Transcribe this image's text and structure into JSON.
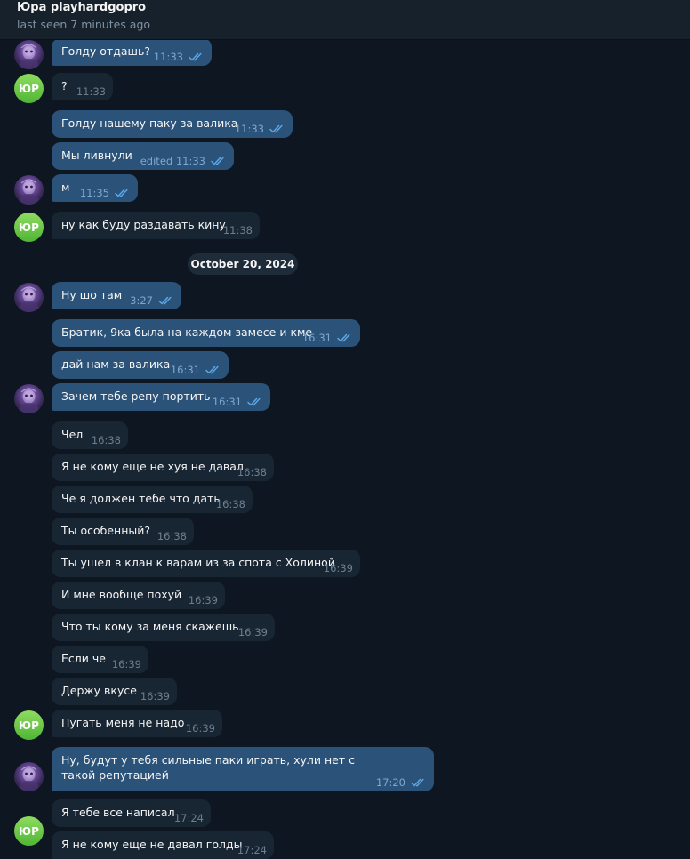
{
  "header": {
    "title": "Юра playhardgopro",
    "status": "last seen 7 minutes ago"
  },
  "colors": {
    "background": "#0e1621",
    "outgoing_bubble": "#2b5278",
    "incoming_bubble": "#182533",
    "read_ticks": "#5aa7e8"
  },
  "avatar_initials": "ЮР",
  "date_separator": "October 20, 2024",
  "messages": [
    {
      "dir": "out",
      "text": "Голду отдашь?",
      "time": "11:33"
    },
    {
      "dir": "in",
      "text": "?",
      "time": "11:33"
    },
    {
      "dir": "out",
      "text": "Голду нашему паку за валика",
      "time": "11:33"
    },
    {
      "dir": "out",
      "text": "Мы ливнули",
      "time": "edited 11:33"
    },
    {
      "dir": "out",
      "text": "м",
      "time": "11:35"
    },
    {
      "dir": "in",
      "text": "ну как буду раздавать кину",
      "time": "11:38"
    },
    {
      "dir": "out",
      "text": "Ну шо там",
      "time": "3:27"
    },
    {
      "dir": "out",
      "text": "Братик, 9ка была на каждом замесе и кме",
      "time": "16:31"
    },
    {
      "dir": "out",
      "text": "дай нам за валика",
      "time": "16:31"
    },
    {
      "dir": "out",
      "text": "Зачем тебе репу портить",
      "time": "16:31"
    },
    {
      "dir": "in",
      "text": "Чел",
      "time": "16:38"
    },
    {
      "dir": "in",
      "text": "Я не кому еще не хуя не давал",
      "time": "16:38"
    },
    {
      "dir": "in",
      "text": "Че я должен тебе что дать",
      "time": "16:38"
    },
    {
      "dir": "in",
      "text": "Ты особенный?",
      "time": "16:38"
    },
    {
      "dir": "in",
      "text": "Ты ушел в клан к варам из за спота с Холиной",
      "time": "16:39"
    },
    {
      "dir": "in",
      "text": "И мне вообще похуй",
      "time": "16:39"
    },
    {
      "dir": "in",
      "text": "Что ты кому за меня скажешь",
      "time": "16:39"
    },
    {
      "dir": "in",
      "text": "Если че",
      "time": "16:39"
    },
    {
      "dir": "in",
      "text": "Держу вкусе",
      "time": "16:39"
    },
    {
      "dir": "in",
      "text": "Пугать меня не надо",
      "time": "16:39"
    },
    {
      "dir": "out",
      "text": "Ну, будут у тебя сильные паки играть, хули нет с такой репутацией",
      "time": "17:20"
    },
    {
      "dir": "in",
      "text": "Я тебе все написал",
      "time": "17:24"
    },
    {
      "dir": "in",
      "text": "Я не кому еще не давал голды",
      "time": "17:24"
    }
  ]
}
